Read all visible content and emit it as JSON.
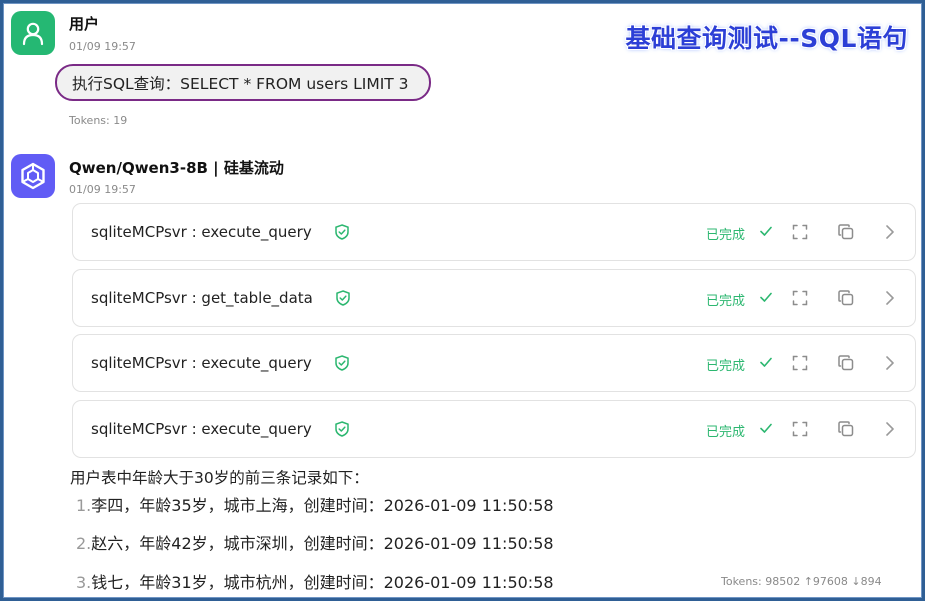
{
  "page_title": "基础查询测试--SQL语句",
  "user_message": {
    "name": "用户",
    "time": "01/09 19:57",
    "text": "执行SQL查询：SELECT * FROM users LIMIT 3",
    "tokens": "Tokens: 19",
    "avatar_icon": "user-icon"
  },
  "assistant_message": {
    "name": "Qwen/Qwen3-8B | 硅基流动",
    "time": "01/09 19:57",
    "avatar_icon": "qwen-logo-icon",
    "tool_calls": [
      {
        "name": "sqliteMCPsvr : execute_query",
        "status": "已完成"
      },
      {
        "name": "sqliteMCPsvr : get_table_data",
        "status": "已完成"
      },
      {
        "name": "sqliteMCPsvr : execute_query",
        "status": "已完成"
      },
      {
        "name": "sqliteMCPsvr : execute_query",
        "status": "已完成"
      }
    ],
    "answer_intro": "用户表中年龄大于30岁的前三条记录如下：",
    "answer_items": [
      {
        "num": "1.",
        "text": "李四，年龄35岁，城市上海，创建时间：2026-01-09 11:50:58"
      },
      {
        "num": "2.",
        "text": "赵六，年龄42岁，城市深圳，创建时间：2026-01-09 11:50:58"
      },
      {
        "num": "3.",
        "text": "钱七，年龄31岁，城市杭州，创建时间：2026-01-09 11:50:58"
      }
    ],
    "tokens": "Tokens: 98502 ↑97608 ↓894"
  },
  "colors": {
    "user_avatar": "#25b873",
    "ai_avatar": "#615cf5",
    "status_green": "#2cb770",
    "bubble_border": "#7a2a86",
    "title_blue": "#2c3fd6"
  }
}
